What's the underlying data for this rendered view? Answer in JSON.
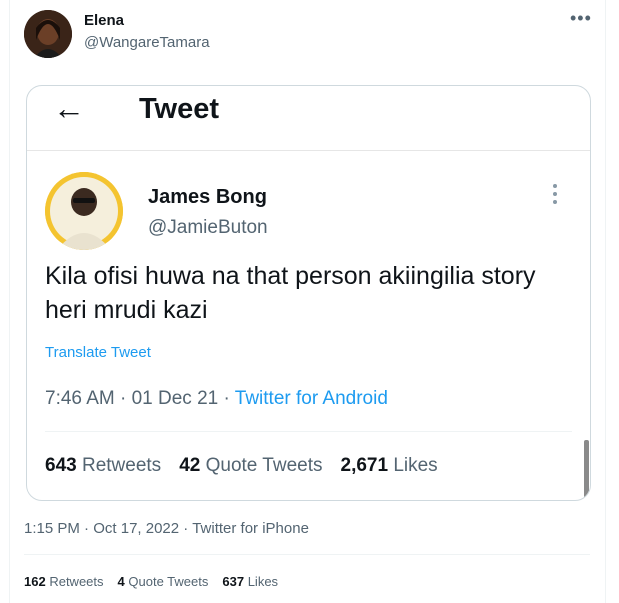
{
  "outer_tweet": {
    "author_name": "Elena",
    "author_handle": "@WangareTamara",
    "more_label": "•••",
    "time": "1:15 PM",
    "date": "Oct 17, 2022",
    "source": "Twitter for iPhone",
    "retweets": "162",
    "retweets_label": "Retweets",
    "quote_tweets": "4",
    "quote_tweets_label": "Quote Tweets",
    "likes": "637",
    "likes_label": "Likes"
  },
  "embedded_screenshot": {
    "header_title": "Tweet",
    "back_arrow": "←",
    "author_name": "James Bong",
    "author_handle": "@JamieButon",
    "text": "Kila ofisi huwa na that person akiingilia story heri mrudi kazi",
    "translate_label": "Translate Tweet",
    "time": "7:46 AM",
    "date": "01 Dec 21",
    "source": "Twitter for Android",
    "retweets": "643",
    "retweets_label": "Retweets",
    "quote_tweets": "42",
    "quote_tweets_label": "Quote Tweets",
    "likes": "2,671",
    "likes_label": "Likes"
  },
  "colors": {
    "link_blue": "#1d9bf0",
    "secondary_text": "#536471",
    "avatar_ring": "#f4c430"
  }
}
